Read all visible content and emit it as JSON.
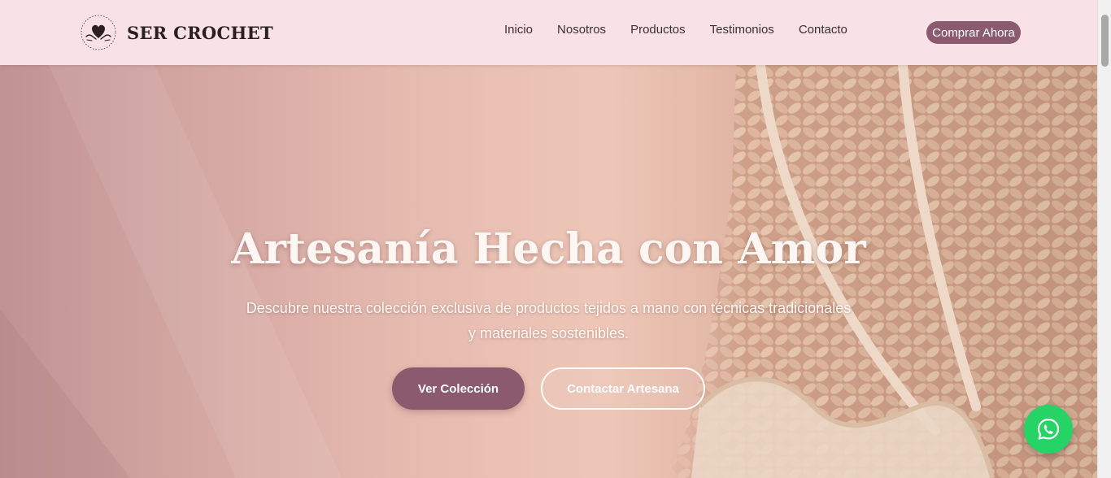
{
  "brand": {
    "name": "SER CROCHET",
    "logo_icon": "heart-hands-logo-icon"
  },
  "nav": {
    "items": [
      {
        "label": "Inicio"
      },
      {
        "label": "Nosotros"
      },
      {
        "label": "Productos"
      },
      {
        "label": "Testimonios"
      },
      {
        "label": "Contacto"
      }
    ],
    "cta_label": "Comprar Ahora"
  },
  "hero": {
    "title": "Artesanía Hecha con Amor",
    "subtitle": "Descubre nuestra colección exclusiva de productos tejidos a mano con técnicas tradicionales y materiales sostenibles.",
    "primary_button": "Ver Colección",
    "secondary_button": "Contactar Artesana"
  },
  "floating": {
    "whatsapp_icon": "whatsapp-icon"
  },
  "colors": {
    "header_bg": "#f8e2e8",
    "accent": "#8b5a6e",
    "whatsapp": "#25d366",
    "text_dark": "#2b1f22"
  }
}
